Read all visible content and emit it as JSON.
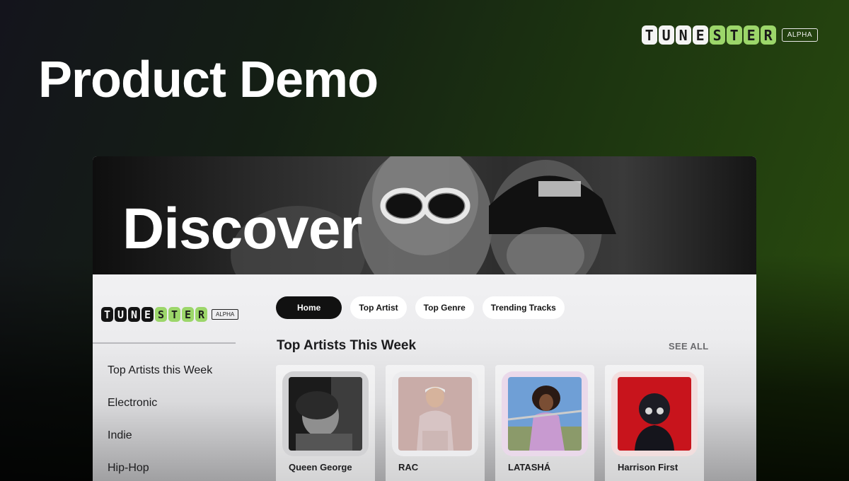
{
  "page": {
    "headline": "Product Demo",
    "brand_letters": [
      "T",
      "U",
      "N",
      "E",
      "S",
      "T",
      "E",
      "R"
    ],
    "alpha_badge": "ALPHA"
  },
  "app": {
    "hero_title": "Discover",
    "sidebar": {
      "alpha_badge": "ALPHA",
      "items": [
        "Top Artists this Week",
        "Electronic",
        "Indie",
        "Hip-Hop"
      ]
    },
    "tabs": [
      {
        "label": "Home",
        "active": true
      },
      {
        "label": "Top Artist",
        "active": false
      },
      {
        "label": "Top Genre",
        "active": false
      },
      {
        "label": "Trending Tracks",
        "active": false
      }
    ],
    "section": {
      "title": "Top Artists This Week",
      "see_all": "SEE ALL"
    },
    "artists": [
      {
        "name": "Queen George",
        "frame_color": "#d2d2d4"
      },
      {
        "name": "RAC",
        "frame_color": "#ececee"
      },
      {
        "name": "LATASHÁ",
        "frame_color": "#ead9ea"
      },
      {
        "name": "Harrison First",
        "frame_color": "#f2dede"
      }
    ]
  },
  "colors": {
    "accent_green": "#9cd66a",
    "active_tab": "#111111",
    "text_dark": "#1b1b1d"
  }
}
